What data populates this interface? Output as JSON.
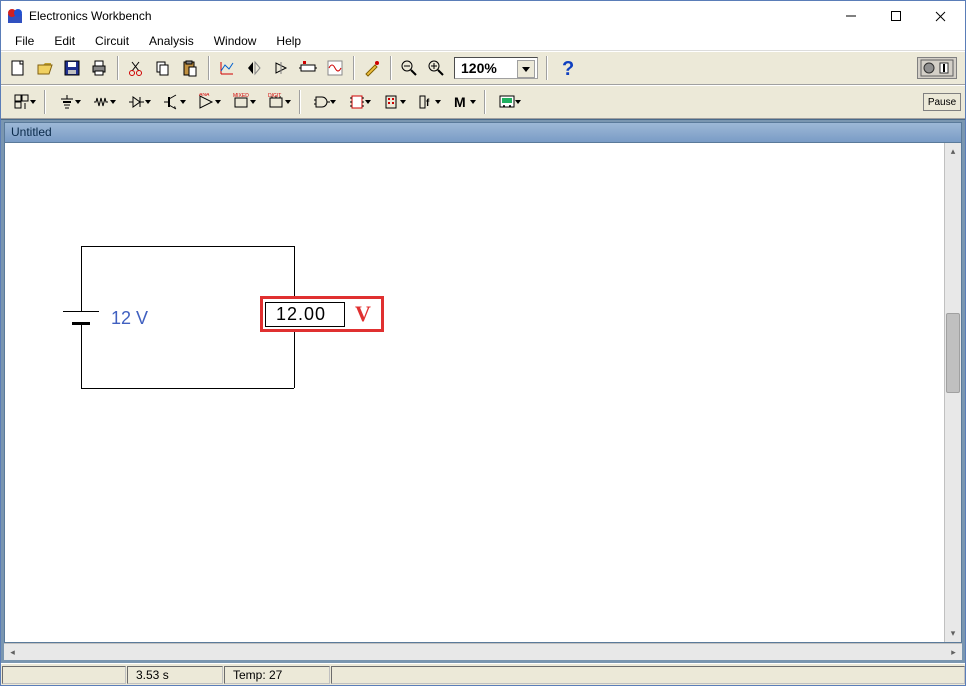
{
  "window": {
    "title": "Electronics Workbench"
  },
  "menus": {
    "file": "File",
    "edit": "Edit",
    "circuit": "Circuit",
    "analysis": "Analysis",
    "window": "Window",
    "help": "Help"
  },
  "toolbar1": {
    "zoom": "120%",
    "icons": {
      "new": "new-file-icon",
      "open": "open-folder-icon",
      "save": "save-icon",
      "print": "print-icon",
      "cut": "cut-icon",
      "copy": "copy-icon",
      "paste": "paste-icon",
      "graph": "graph-icon",
      "flip": "flip-horizontal-icon",
      "rotate": "rotate-icon",
      "componentprops": "component-props-icon",
      "osc": "waveform-icon",
      "probe": "probe-icon",
      "zoomout": "zoom-out-icon",
      "zoomin": "zoom-in-icon",
      "help": "help-icon"
    }
  },
  "toolbar2": {
    "pause_label": "Pause",
    "icons": {
      "parts": "parts-bin-icon",
      "source": "sources-icon",
      "resistor": "basic-icon",
      "diode": "diode-icon",
      "transistor": "transistor-icon",
      "analog": "analog-ic-icon",
      "mixed": "mixed-ic-icon",
      "digital": "digital-ic-icon",
      "gate": "logic-gate-icon",
      "dip": "dip-chip-icon",
      "display": "indicator-icon",
      "ctrl": "control-icon",
      "misc": "misc-icon",
      "instr": "instrument-icon"
    }
  },
  "document": {
    "title": "Untitled"
  },
  "circuit": {
    "battery_label": "12 V",
    "voltmeter_reading": "12.00",
    "voltmeter_unit": "V"
  },
  "statusbar": {
    "time": "3.53 s",
    "temp_label": "Temp:  27"
  }
}
